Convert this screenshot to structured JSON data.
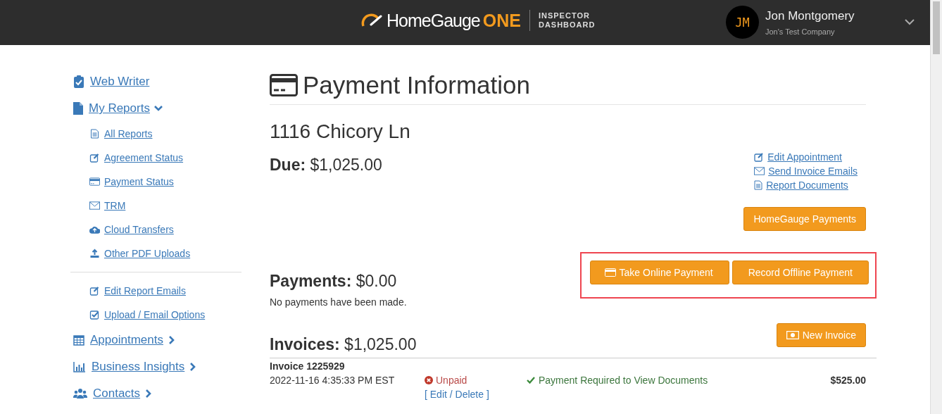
{
  "header": {
    "brand": "HomeGauge",
    "brand_accent": "ONE",
    "subtitle_line1": "INSPECTOR",
    "subtitle_line2": "DASHBOARD",
    "user": {
      "initials": "JM",
      "name": "Jon Montgomery",
      "company": "Jon's Test Company"
    }
  },
  "sidebar": {
    "items": [
      {
        "label": "Web Writer"
      },
      {
        "label": "My Reports",
        "expanded": true,
        "children": [
          {
            "label": "All Reports"
          },
          {
            "label": "Agreement Status"
          },
          {
            "label": "Payment Status"
          },
          {
            "label": "TRM"
          },
          {
            "label": "Cloud Transfers"
          },
          {
            "label": "Other PDF Uploads"
          }
        ]
      }
    ],
    "settings_links": [
      {
        "label": "Edit Report Emails"
      },
      {
        "label": "Upload / Email Options"
      }
    ],
    "more_items": [
      {
        "label": "Appointments",
        "expanded": false
      },
      {
        "label": "Business Insights",
        "expanded": false
      },
      {
        "label": "Contacts",
        "expanded": false
      }
    ]
  },
  "page": {
    "title": "Payment Information",
    "address": "1116 Chicory Ln",
    "due_label": "Due:",
    "due_amount": "$1,025.00",
    "links": [
      {
        "label": "Edit Appointment"
      },
      {
        "label": "Send Invoice Emails"
      },
      {
        "label": "Report Documents"
      }
    ],
    "homegauge_button": "HomeGauge Payments",
    "payments_label": "Payments:",
    "payments_amount": "$0.00",
    "payments_note": "No payments have been made.",
    "payment_buttons": [
      {
        "label": "Take Online Payment"
      },
      {
        "label": "Record Offline Payment"
      }
    ],
    "highlighted": true,
    "invoices_label": "Invoices:",
    "invoices_amount": "$1,025.00",
    "new_invoice_button": "New Invoice",
    "invoices": [
      {
        "title": "Invoice 1225929",
        "date": "2022-11-16 4:35:33 PM EST",
        "status": "Unpaid",
        "paid": false,
        "actions": "[ Edit / Delete ]",
        "requirement": "Payment Required to View Documents",
        "amount": "$525.00"
      }
    ]
  }
}
